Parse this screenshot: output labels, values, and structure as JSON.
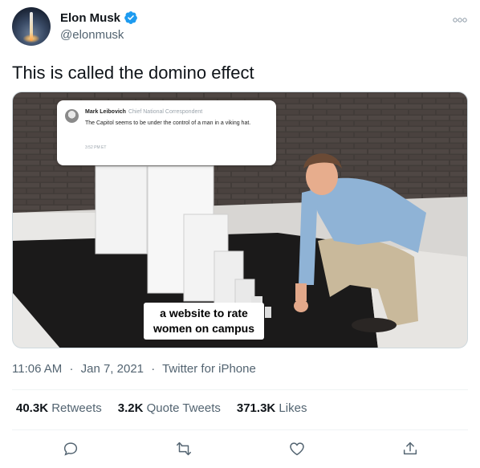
{
  "author": {
    "display_name": "Elon Musk",
    "handle": "@elonmusk",
    "verified": true,
    "avatar_icon": "avatar-rocket-launch"
  },
  "tweet": {
    "text": "This is called the domino effect"
  },
  "media": {
    "quote": {
      "name": "Mark Leibovich",
      "role": "Chief National Correspondent",
      "text": "The Capitol seems to be under the control of a man in a viking hat.",
      "time": "3:52 PM ET"
    },
    "caption_line1": "a website to rate",
    "caption_line2": "women on campus"
  },
  "meta": {
    "time": "11:06 AM",
    "date": "Jan 7, 2021",
    "client": "Twitter for iPhone",
    "separator": "·"
  },
  "stats": {
    "retweets_count": "40.3K",
    "retweets_label": "Retweets",
    "quote_count": "3.2K",
    "quote_label": "Quote Tweets",
    "likes_count": "371.3K",
    "likes_label": "Likes"
  },
  "actions": [
    "reply-icon",
    "retweet-icon",
    "like-icon",
    "share-icon"
  ],
  "colors": {
    "verified_blue": "#1d9bf0",
    "secondary_text": "#536471",
    "action_icon": "#536471"
  }
}
